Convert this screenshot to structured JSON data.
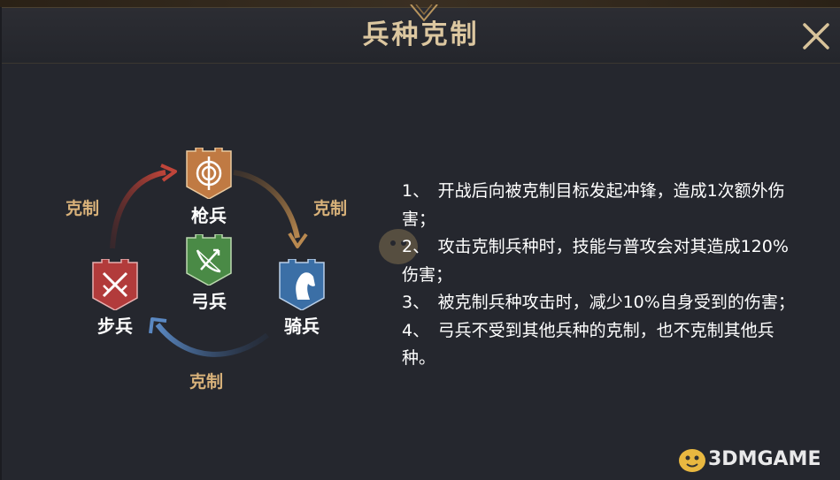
{
  "dialog": {
    "title": "兵种克制",
    "close_icon": "close-icon"
  },
  "units": {
    "spearman": {
      "label": "枪兵",
      "icon": "spear-target-icon",
      "color": "#c07a43"
    },
    "archer": {
      "label": "弓兵",
      "icon": "bow-icon",
      "color": "#4a8a46"
    },
    "cavalry": {
      "label": "骑兵",
      "icon": "horse-head-icon",
      "color": "#3b6fa6"
    },
    "infantry": {
      "label": "步兵",
      "icon": "crossed-swords-icon",
      "color": "#b23b3b"
    }
  },
  "counter_labels": {
    "spear_over_cavalry": "克制",
    "infantry_over_spear": "克制",
    "cavalry_over_infantry": "克制"
  },
  "rules": [
    "1、　开战后向被克制目标发起冲锋，造成1次额外伤害；",
    "2、　攻击克制兵种时，技能与普攻会对其造成120%伤害；",
    "3、　被克制兵种攻击时，减少10%自身受到的伤害；",
    "4、　弓兵不受到其他兵种的克制，也不克制其他兵种。"
  ],
  "colors": {
    "title_gold": "#dcc7a0",
    "counter_gold": "#d9b27a",
    "panel_bg": "#25272e"
  },
  "watermark": {
    "text": "3DMGAME",
    "icon": "mascot-logo-icon"
  }
}
